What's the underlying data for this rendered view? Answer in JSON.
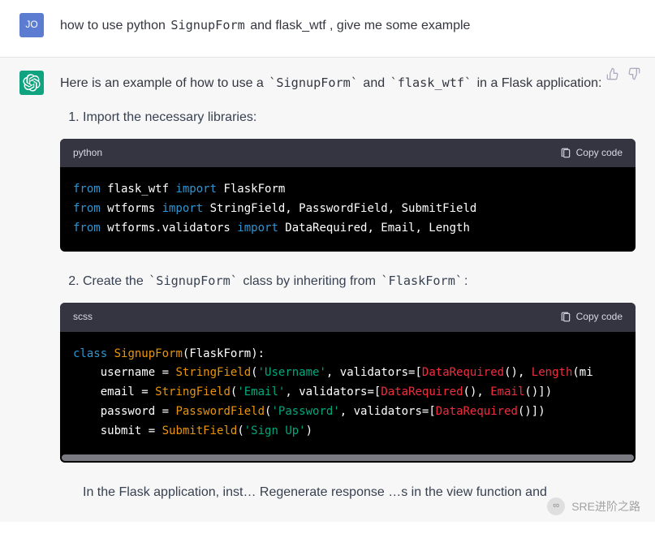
{
  "user": {
    "avatar_initials": "JO",
    "message_prefix": "how to use python  ",
    "message_code1": "SignupForm",
    "message_mid": "  and ",
    "message_code2": "flask_wtf",
    "message_suffix": " , give me some example"
  },
  "assistant": {
    "intro_prefix": "Here is an example of how to use a ",
    "intro_code1": "`SignupForm`",
    "intro_mid": " and ",
    "intro_code2": "`flask_wtf`",
    "intro_suffix": " in a Flask application:",
    "steps": {
      "s1": "Import the necessary libraries:",
      "s2_prefix": "Create the ",
      "s2_code1": "`SignupForm`",
      "s2_mid": " class by inheriting from ",
      "s2_code2": "`FlaskForm`",
      "s2_suffix": ":",
      "s3_partial": "In the Flask application, inst…  Regenerate response  …s in the view function and"
    },
    "code1": {
      "lang": "python",
      "copy_label": "Copy code",
      "lines": [
        {
          "kw": "from",
          "mod": " flask_wtf ",
          "kw2": "import",
          "rest": " FlaskForm"
        },
        {
          "kw": "from",
          "mod": " wtforms ",
          "kw2": "import",
          "rest": " StringField, PasswordField, SubmitField"
        },
        {
          "kw": "from",
          "mod": " wtforms.validators ",
          "kw2": "import",
          "rest": " DataRequired, Email, Length"
        }
      ]
    },
    "code2": {
      "lang": "scss",
      "copy_label": "Copy code",
      "content": {
        "class_kw": "class",
        "class_name": "SignupForm",
        "base": "FlaskForm",
        "fields": [
          {
            "name": "username",
            "ctor": "StringField",
            "str": "'Username'",
            "after_str": ", validators=[",
            "calls": [
              {
                "n": "DataRequired",
                "args": "()"
              },
              {
                "sep": ", "
              },
              {
                "n": "Length",
                "args": "(mi"
              }
            ]
          },
          {
            "name": "email",
            "ctor": "StringField",
            "str": "'Email'",
            "after_str": ", validators=[",
            "calls": [
              {
                "n": "DataRequired",
                "args": "()"
              },
              {
                "sep": ", "
              },
              {
                "n": "Email",
                "args": "()]"
              }
            ],
            "close": ")"
          },
          {
            "name": "password",
            "ctor": "PasswordField",
            "str": "'Password'",
            "after_str": ", validators=[",
            "calls": [
              {
                "n": "DataRequired",
                "args": "()]"
              }
            ],
            "close": ")"
          },
          {
            "name": "submit",
            "ctor": "SubmitField",
            "str": "'Sign Up'",
            "after_str": "",
            "calls": [],
            "close": ")"
          }
        ]
      }
    }
  },
  "watermark": {
    "icon": "∞",
    "text": "SRE进阶之路"
  }
}
